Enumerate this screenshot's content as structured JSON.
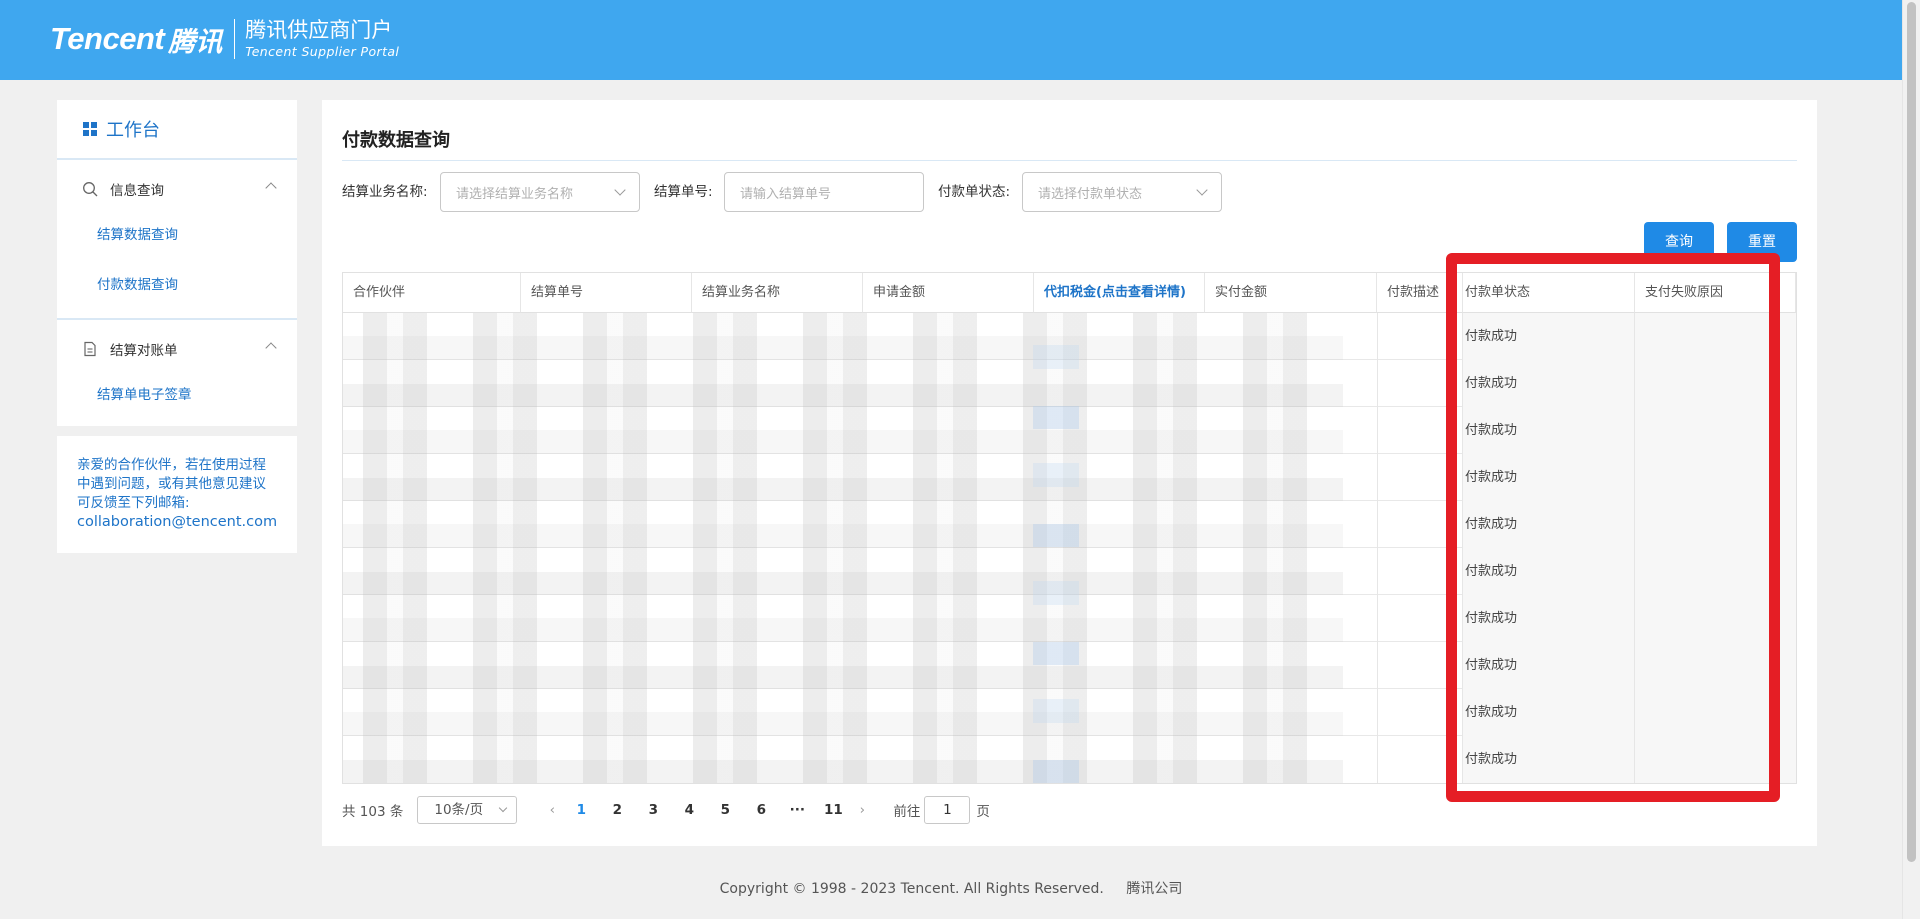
{
  "header": {
    "brand_en": "Tencent",
    "brand_cn": "腾讯",
    "portal_cn": "腾讯供应商门户",
    "portal_en": "Tencent Supplier Portal"
  },
  "sidebar": {
    "workbench": "工作台",
    "groups": [
      {
        "title": "信息查询",
        "icon": "search-icon",
        "items": [
          "结算数据查询",
          "付款数据查询"
        ]
      },
      {
        "title": "结算对账单",
        "icon": "document-icon",
        "items": [
          "结算单电子签章"
        ]
      }
    ],
    "help_text": "亲爱的合作伙伴，若在使用过程中遇到问题，或有其他意见建议可反馈至下列邮箱:",
    "help_email": "collaboration@tencent.com"
  },
  "main": {
    "title": "付款数据查询",
    "filters": {
      "biz_name_label": "结算业务名称:",
      "biz_name_placeholder": "请选择结算业务名称",
      "order_no_label": "结算单号:",
      "order_no_placeholder": "请输入结算单号",
      "status_label": "付款单状态:",
      "status_placeholder": "请选择付款单状态"
    },
    "buttons": {
      "query": "查询",
      "reset": "重置"
    },
    "columns": [
      "合作伙伴",
      "结算单号",
      "结算业务名称",
      "申请金额",
      "代扣税金(点击查看详情)",
      "实付金额",
      "付款描述",
      "付款单状态",
      "支付失败原因"
    ],
    "rows": [
      {
        "status": "付款成功",
        "reason": ""
      },
      {
        "status": "付款成功",
        "reason": ""
      },
      {
        "status": "付款成功",
        "reason": ""
      },
      {
        "status": "付款成功",
        "reason": ""
      },
      {
        "status": "付款成功",
        "reason": ""
      },
      {
        "status": "付款成功",
        "reason": ""
      },
      {
        "status": "付款成功",
        "reason": ""
      },
      {
        "status": "付款成功",
        "reason": ""
      },
      {
        "status": "付款成功",
        "reason": ""
      },
      {
        "status": "付款成功",
        "reason": ""
      }
    ],
    "pagination": {
      "total": "共 103 条",
      "page_size": "10条/页",
      "pages": [
        "1",
        "2",
        "3",
        "4",
        "5",
        "6",
        "···",
        "11"
      ],
      "current": "1",
      "goto_label": "前往",
      "goto_value": "1",
      "page_suffix": "页"
    }
  },
  "footer": {
    "copyright": "Copyright © 1998 - 2023 Tencent. All Rights Reserved.",
    "company": "腾讯公司"
  },
  "colors": {
    "header": "#3fa7ef",
    "accent": "#1f8ae6",
    "highlight": "#e51e25"
  }
}
